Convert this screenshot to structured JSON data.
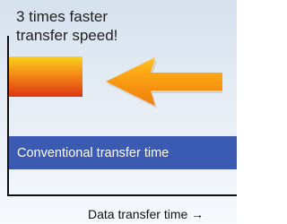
{
  "headline": [
    "3 times faster",
    "transfer speed!"
  ],
  "bars": {
    "new": {
      "name": "new-transfer-time",
      "color": "#ee6a14"
    },
    "conventional": {
      "label": "Conventional transfer time",
      "color": "#3b5bb2"
    }
  },
  "axis": {
    "x_label": "Data transfer time →"
  },
  "icons": {
    "arrow": "left-arrow-icon"
  }
}
